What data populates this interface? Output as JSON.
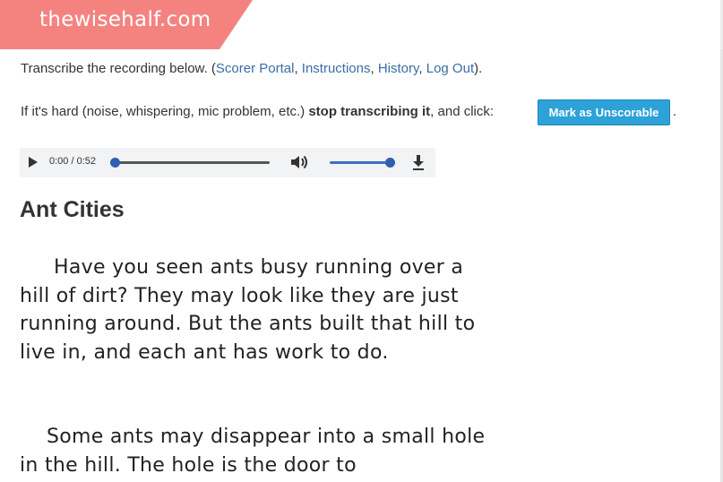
{
  "brand": {
    "site_name": "thewisehalf.com",
    "banner_color": "#f4837f"
  },
  "instructions": {
    "prefix": "Transcribe the recording below. (",
    "links": [
      "Scorer Portal",
      "Instructions",
      "History",
      "Log Out"
    ],
    "sep": ", ",
    "suffix": ").",
    "hard_prefix": "If it's hard (noise, whispering, mic problem, etc.) ",
    "hard_bold": "stop transcribing it",
    "hard_suffix": ", and click:",
    "trailing": "."
  },
  "unscorable_button": {
    "label": "Mark as Unscorable",
    "color": "#2ca2d8"
  },
  "audio": {
    "time": "0:00 / 0:52",
    "progress_fraction": 0,
    "volume_fraction": 1,
    "icons": [
      "play-icon",
      "volume-icon",
      "download-icon"
    ]
  },
  "story": {
    "title": "Ant Cities",
    "paragraphs": [
      "Have you seen ants busy running over a hill of dirt? They may look like they are just running around. But the ants built that hill to live in, and each ant has work to do.",
      "Some ants may disappear into a small hole in the hill. The hole is the door to"
    ]
  },
  "colors": {
    "link": "#3a6ea5",
    "player_bg": "#f1f3f4",
    "slider": "#2e5fb0"
  }
}
